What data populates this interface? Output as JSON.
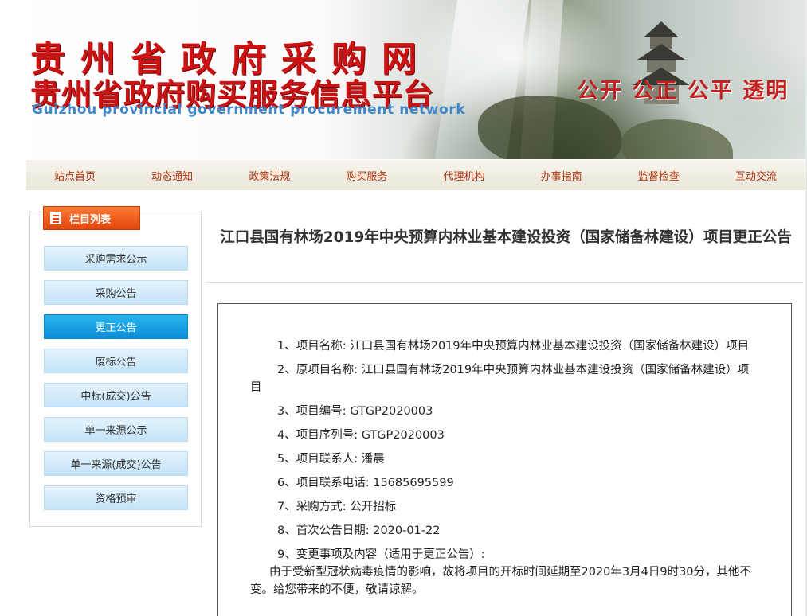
{
  "banner": {
    "title_cn_1": "贵州省政府采购网",
    "title_cn_2": "贵州省政府购买服务信息平台",
    "title_en": "Guizhou provincial government procurement network",
    "slogan": "公开 公正 公平 透明"
  },
  "nav": {
    "items": [
      "站点首页",
      "动态通知",
      "政策法规",
      "购买服务",
      "代理机构",
      "办事指南",
      "监督检查",
      "互动交流"
    ]
  },
  "sidebar": {
    "header": "栏目列表",
    "items": [
      "采购需求公示",
      "采购公告",
      "更正公告",
      "废标公告",
      "中标(成交)公告",
      "单一来源公示",
      "单一来源(成交)公告",
      "资格预审"
    ],
    "active": "更正公告"
  },
  "article": {
    "title": "江口县国有林场2019年中央预算内林业基本建设投资（国家储备林建设）项目更正公告",
    "lines": [
      "1、项目名称: 江口县国有林场2019年中央预算内林业基本建设投资（国家储备林建设）项目",
      "2、原项目名称: 江口县国有林场2019年中央预算内林业基本建设投资（国家储备林建设）项目",
      "3、项目编号: GTGP2020003",
      "4、项目序列号: GTGP2020003",
      "5、项目联系人: 潘晨",
      "6、项目联系电话: 15685695599",
      "7、采购方式: 公开招标",
      "8、首次公告日期: 2020-01-22",
      "9、变更事项及内容（适用于更正公告）:",
      "由于受新型冠状病毒疫情的影响，故将项目的开标时间延期至2020年3月4日9时30分，其他不变。给您带来的不便，敬请谅解。"
    ]
  }
}
